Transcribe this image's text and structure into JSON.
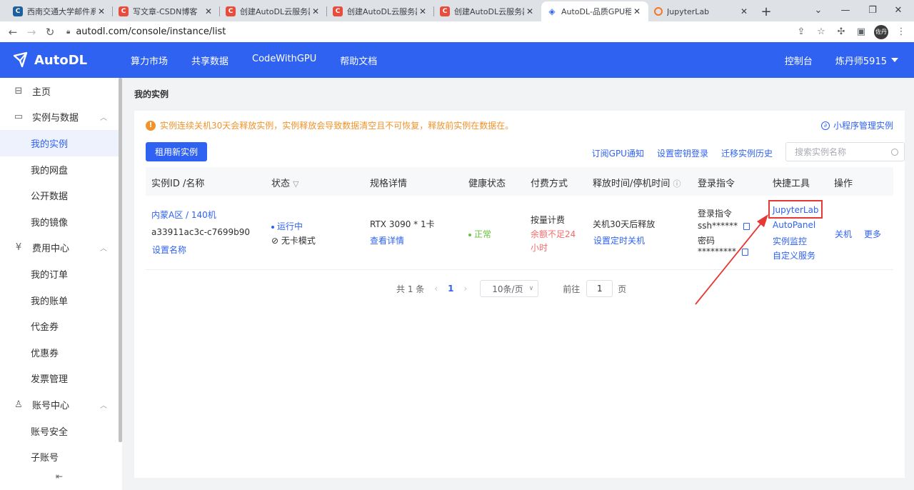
{
  "browser": {
    "tabs": [
      {
        "title": "西南交通大学邮件系统",
        "icon": "c-icon",
        "active": false
      },
      {
        "title": "写文章-CSDN博客",
        "icon": "csdn-icon",
        "active": false
      },
      {
        "title": "创建AutoDL云服务器",
        "icon": "csdn-icon",
        "active": false
      },
      {
        "title": "创建AutoDL云服务器",
        "icon": "csdn-icon",
        "active": false
      },
      {
        "title": "创建AutoDL云服务器",
        "icon": "csdn-icon",
        "active": false
      },
      {
        "title": "AutoDL-品质GPU租用",
        "icon": "autodl-icon",
        "active": true
      },
      {
        "title": "JupyterLab",
        "icon": "jupyter-icon",
        "active": false
      }
    ],
    "url": "autodl.com/console/instance/list",
    "profile_initials": "佐丹"
  },
  "header": {
    "logo_text": "AutoDL",
    "nav": [
      "算力市场",
      "共享数据",
      "CodeWithGPU",
      "帮助文档"
    ],
    "console_label": "控制台",
    "username": "炼丹师5915"
  },
  "sidebar": {
    "home": "主页",
    "instances_group": "实例与数据",
    "instances_items": [
      "我的实例",
      "我的网盘",
      "公开数据",
      "我的镜像"
    ],
    "billing_group": "费用中心",
    "billing_items": [
      "我的订单",
      "我的账单",
      "代金券",
      "优惠券",
      "发票管理"
    ],
    "account_group": "账号中心",
    "account_items": [
      "账号安全",
      "子账号"
    ]
  },
  "main": {
    "page_title": "我的实例",
    "notice": "实例连续关机30天会释放实例，实例释放会导致数据清空且不可恢复，释放前实例在数据在。",
    "mini_program": "小程序管理实例",
    "rent_button": "租用新实例",
    "top_links": [
      "订阅GPU通知",
      "设置密钥登录",
      "迁移实例历史"
    ],
    "search_placeholder": "搜索实例名称"
  },
  "table": {
    "headers": {
      "id": "实例ID /名称",
      "status": "状态",
      "spec": "规格详情",
      "health": "健康状态",
      "billing": "付费方式",
      "release": "释放时间/停机时间",
      "login": "登录指令",
      "tools": "快捷工具",
      "ops": "操作"
    },
    "row": {
      "region": "内蒙A区 / 140机",
      "instance_id": "a33911ac3c-c7699b90",
      "set_name": "设置名称",
      "status": "运行中",
      "mode": "无卡模式",
      "gpu": "RTX 3090 * 1卡",
      "view_detail": "查看详情",
      "health": "正常",
      "billing_type": "按量计费",
      "balance_warn_1": "余额不足24",
      "balance_warn_2": "小时",
      "release_text": "关机30天后释放",
      "set_shutdown": "设置定时关机",
      "login_label": "登录指令",
      "ssh_masked": "ssh******",
      "password_label": "密码",
      "password_masked": "*********",
      "tools": [
        "JupyterLab",
        "AutoPanel",
        "实例监控",
        "自定义服务"
      ],
      "op_shutdown": "关机",
      "op_more": "更多"
    }
  },
  "pagination": {
    "total": "共 1 条",
    "current_page": "1",
    "page_size": "10条/页",
    "goto_label": "前往",
    "goto_value": "1",
    "page_unit": "页"
  },
  "colors": {
    "brand": "#2f62f1",
    "warning": "#f0932b",
    "danger": "#f56c6c",
    "success": "#67c23a",
    "annotation": "#e53935"
  }
}
